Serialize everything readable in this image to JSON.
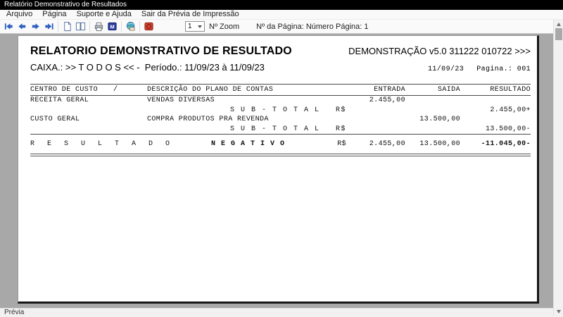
{
  "window": {
    "title": "Relatório Demonstrativo de Resultados"
  },
  "menubar": {
    "items": [
      "Arquivo",
      "Página",
      "Suporte e Ajuda",
      "Sair da Prévia de Impressão"
    ]
  },
  "toolbar": {
    "icons": [
      "first-page",
      "previous-page",
      "next-page",
      "last-page",
      "single-page-view",
      "book-view",
      "print",
      "matrix-print",
      "web-export",
      "close-preview"
    ],
    "zoom": {
      "value": "1",
      "label": "Nº Zoom"
    },
    "page_info": "Nº da Página: Número Página: 1"
  },
  "report": {
    "title": "RELATORIO DEMONSTRATIVO DE RESULTADO",
    "edition": "DEMONSTRAÇÃO v5.0 311222 010722 >>>",
    "filter": "CAIXA.: >> T O D O S << -  Período.: 11/09/23 à 11/09/23",
    "date": "11/09/23",
    "page_label": "Pagina.: 001",
    "table": {
      "headers": {
        "centro": "CENTRO DE CUSTO",
        "slash": "/",
        "descricao": "DESCRIÇÃO DO PLANO DE CONTAS",
        "entrada": "ENTRADA",
        "saida": "SAIDA",
        "resultado": "RESULTADO"
      },
      "rows": [
        {
          "centro": "RECEITA GERAL",
          "descricao": "VENDAS DIVERSAS",
          "entrada": "2.455,00",
          "saida": "",
          "resultado": ""
        },
        {
          "label": "S U B - T O T A L   R$",
          "resultado": "2.455,00+"
        },
        {
          "centro": "CUSTO GERAL",
          "descricao": "COMPRA PRODUTOS PRA REVENDA",
          "entrada": "",
          "saida": "13.500,00",
          "resultado": ""
        },
        {
          "label": "S U B - T O T A L   R$",
          "resultado": "13.500,00-"
        }
      ],
      "total": {
        "label": "R E S U L T A D O",
        "status": "N E G A T I V O",
        "currency": "R$",
        "entrada": "2.455,00",
        "saida": "13.500,00",
        "resultado": "-11.045,00-"
      }
    }
  },
  "statusbar": {
    "text": "Prévia"
  },
  "colors": {
    "accent_blue": "#3060c0",
    "close_red": "#d24535",
    "viewport_gray": "#a8a8a8",
    "titlebar_black": "#000000"
  }
}
